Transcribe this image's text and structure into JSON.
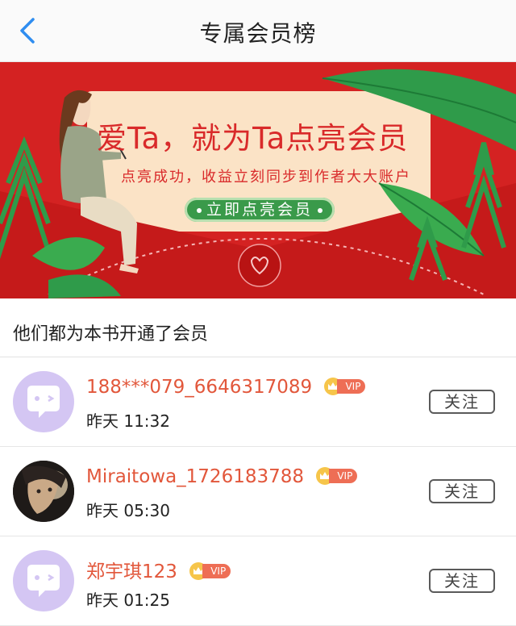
{
  "header": {
    "title": "专属会员榜",
    "back_icon": "chevron-left-icon"
  },
  "banner": {
    "title": "爱Ta，就为Ta点亮会员",
    "subtitle": "点亮成功，收益立刻同步到作者大大账户",
    "button_label": "立即点亮会员",
    "colors": {
      "background": "#d42222",
      "card": "#fbe3c6",
      "button": "#3a9a4a"
    }
  },
  "section": {
    "title": "他们都为本书开通了会员"
  },
  "members": [
    {
      "name": "188***079_6646317089",
      "vip_label": "VIP",
      "time": "昨天 11:32",
      "follow_label": "关注",
      "avatar": "default"
    },
    {
      "name": "Miraitowa_1726183788",
      "vip_label": "VIP",
      "time": "昨天 05:30",
      "follow_label": "关注",
      "avatar": "photo"
    },
    {
      "name": "郑宇琪123",
      "vip_label": "VIP",
      "time": "昨天 01:25",
      "follow_label": "关注",
      "avatar": "default"
    }
  ],
  "colors": {
    "name": "#e2573b",
    "vip": "#ee6e55",
    "accent_back": "#2f8df0"
  }
}
